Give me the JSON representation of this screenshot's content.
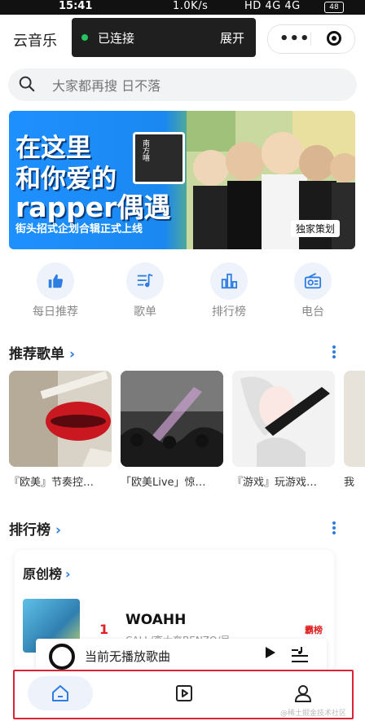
{
  "status_bar": {
    "time": "15:41",
    "network_speed": "1.0K/s",
    "indicators": "HD 4G 4G",
    "battery": "48"
  },
  "app": {
    "name": "云音乐"
  },
  "toast": {
    "message": "已连接",
    "action": "展开"
  },
  "search": {
    "placeholder": "大家都再搜 日不落"
  },
  "banner": {
    "line1": "在这里",
    "line2": "和你爱的",
    "line3": "rapper偶遇",
    "subtitle": "街头招式企划合辑正式上线",
    "badge": "南方嘻",
    "tag": "独家策划"
  },
  "quick_entries": [
    {
      "label": "每日推荐",
      "icon": "thumbs-up-icon"
    },
    {
      "label": "歌单",
      "icon": "playlist-icon"
    },
    {
      "label": "排行榜",
      "icon": "bar-chart-icon"
    },
    {
      "label": "电台",
      "icon": "radio-icon"
    }
  ],
  "recommended_playlists": {
    "title": "推荐歌单",
    "items": [
      {
        "title": "『欧美』节奏控…"
      },
      {
        "title": "「欧美Live」惊…"
      },
      {
        "title": "『游戏』玩游戏…"
      },
      {
        "title": "我"
      }
    ]
  },
  "rankings": {
    "title": "排行榜",
    "card_title": "原创榜",
    "entry": {
      "rank": "1",
      "song": "WOAHH",
      "artist": "CALL/李大奔BENZO/吴",
      "badge": "霸榜"
    }
  },
  "mini_player": {
    "text": "当前无播放歌曲"
  },
  "watermark": "@稀土掘金技术社区",
  "colors": {
    "accent": "#2e7de0",
    "rank_red": "#e02020",
    "toast_dot": "#22c55e"
  }
}
